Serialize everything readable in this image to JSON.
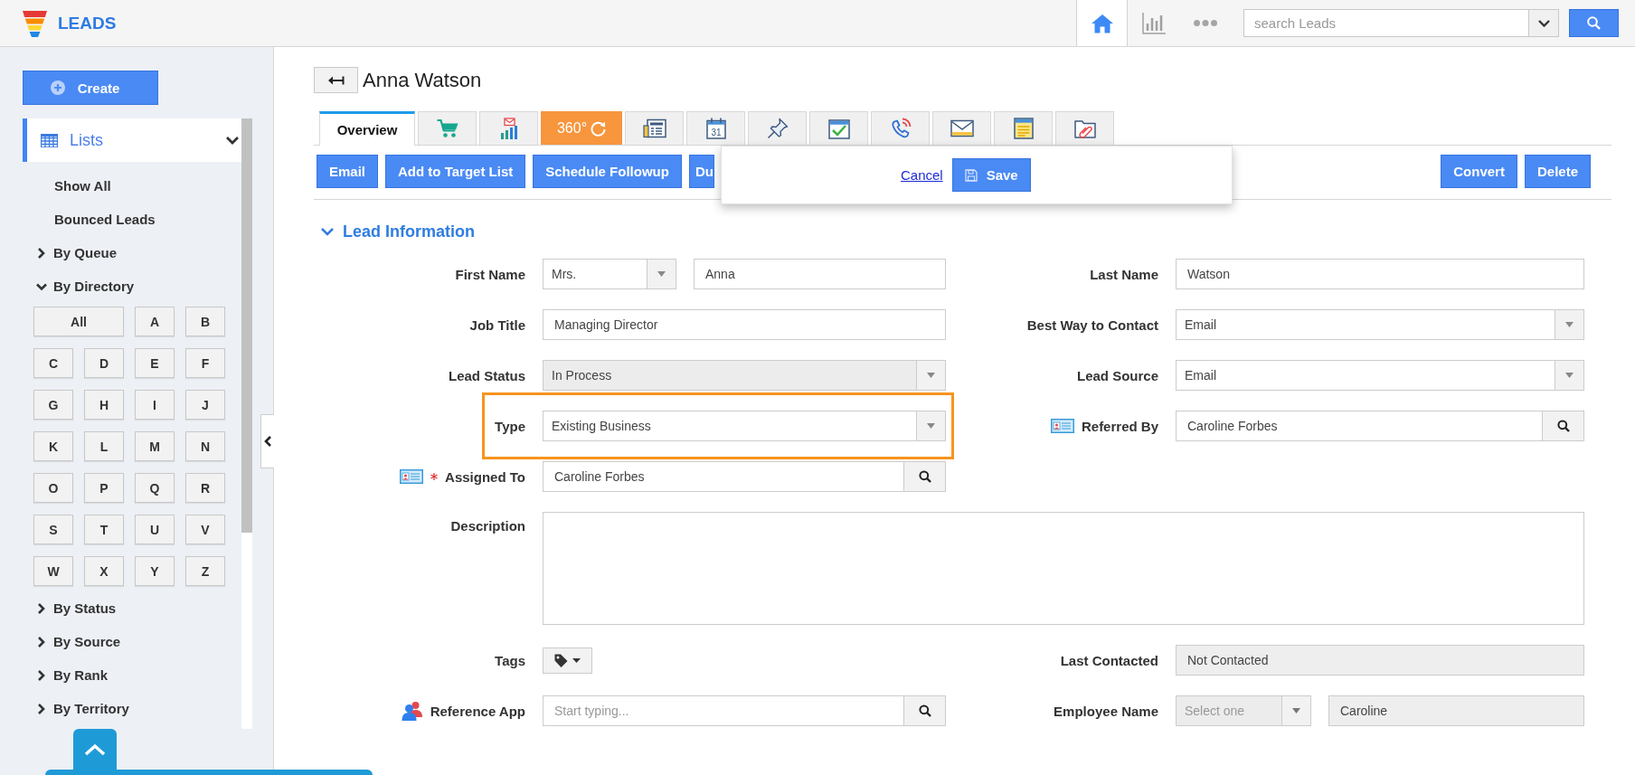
{
  "app": {
    "title": "LEADS"
  },
  "nav": [
    {
      "selected": true
    },
    {
      "selected": false
    },
    {
      "selected": false
    }
  ],
  "search": {
    "placeholder": "search Leads"
  },
  "sidebar": {
    "create": "Create",
    "lists": {
      "label": "Lists",
      "expanded": true
    },
    "links": [
      {
        "label": "Show All"
      },
      {
        "label": "Bounced Leads"
      }
    ],
    "groups": [
      {
        "label": "By Queue",
        "expanded": false
      },
      {
        "label": "By Directory",
        "expanded": true,
        "letters": [
          "All",
          "A",
          "B",
          "C",
          "D",
          "E",
          "F",
          "G",
          "H",
          "I",
          "J",
          "K",
          "L",
          "M",
          "N",
          "O",
          "P",
          "Q",
          "R",
          "S",
          "T",
          "U",
          "V",
          "W",
          "X",
          "Y",
          "Z"
        ]
      },
      {
        "label": "By Status",
        "expanded": false
      },
      {
        "label": "By Source",
        "expanded": false
      },
      {
        "label": "By Rank",
        "expanded": false
      },
      {
        "label": "By Territory",
        "expanded": false
      }
    ]
  },
  "record": {
    "title": "Anna Watson"
  },
  "tabs": [
    {
      "kind": "text",
      "label": "Overview",
      "selected": true
    },
    {
      "kind": "icon",
      "selected": false
    },
    {
      "kind": "icon",
      "selected": false
    },
    {
      "kind": "badge",
      "label": "360°",
      "selected": false
    },
    {
      "kind": "icon",
      "selected": false
    },
    {
      "kind": "calendar",
      "label": "31",
      "selected": false
    },
    {
      "kind": "icon",
      "selected": false
    },
    {
      "kind": "icon",
      "selected": false
    },
    {
      "kind": "icon",
      "selected": false
    },
    {
      "kind": "icon",
      "selected": false
    },
    {
      "kind": "icon",
      "selected": false
    },
    {
      "kind": "icon",
      "selected": false
    }
  ],
  "actions": {
    "left": [
      {
        "label": "Email",
        "covered": false
      },
      {
        "label": "Add to Target List",
        "covered": false
      },
      {
        "label": "Schedule Followup",
        "covered": false
      },
      {
        "label": "Du",
        "covered": true
      }
    ],
    "right": [
      {
        "label": "Convert"
      },
      {
        "label": "Delete"
      }
    ]
  },
  "popup": {
    "cancel": "Cancel",
    "save": "Save"
  },
  "form": {
    "title": "Lead Information",
    "expanded": true,
    "rows": [
      {
        "fields": [
          {
            "kind": "name",
            "label": "First Name",
            "salutation": "Mrs.",
            "value": "Anna",
            "disabled": false,
            "required": false,
            "highlighted": false
          },
          {
            "kind": "text",
            "label": "Last Name",
            "value": "Watson",
            "disabled": false,
            "required": false,
            "highlighted": false
          }
        ]
      },
      {
        "fields": [
          {
            "kind": "text",
            "label": "Job Title",
            "value": "Managing Director",
            "disabled": false,
            "required": false,
            "highlighted": false
          },
          {
            "kind": "select",
            "label": "Best Way to Contact",
            "value": "Email",
            "disabled": false,
            "required": false,
            "highlighted": false
          }
        ]
      },
      {
        "fields": [
          {
            "kind": "select",
            "label": "Lead Status",
            "value": "In Process",
            "disabled": true,
            "required": false,
            "highlighted": false
          },
          {
            "kind": "select",
            "label": "Lead Source",
            "value": "Email",
            "disabled": false,
            "required": false,
            "highlighted": false
          }
        ]
      },
      {
        "fields": [
          {
            "kind": "select",
            "label": "Type",
            "value": "Existing Business",
            "disabled": false,
            "required": false,
            "highlighted": true
          },
          {
            "kind": "lookup",
            "label": "Referred By",
            "value": "Caroline Forbes",
            "disabled": false,
            "required": false,
            "highlighted": false
          }
        ]
      },
      {
        "fields": [
          {
            "kind": "lookup",
            "label": "Assigned To",
            "value": "Caroline Forbes",
            "disabled": false,
            "required": true,
            "highlighted": false
          }
        ]
      },
      {
        "fields": [
          {
            "kind": "textarea",
            "label": "Description",
            "disabled": false,
            "required": false,
            "highlighted": false
          }
        ]
      },
      {
        "fields": [
          {
            "kind": "tags",
            "label": "Tags",
            "disabled": false,
            "required": false,
            "highlighted": false
          },
          {
            "kind": "text",
            "label": "Last Contacted",
            "value": "Not Contacted",
            "disabled": true,
            "required": false,
            "highlighted": false
          }
        ]
      },
      {
        "fields": [
          {
            "kind": "reference",
            "label": "Reference App",
            "placeholder": "Start typing...",
            "disabled": false,
            "required": false,
            "highlighted": false
          },
          {
            "kind": "employee",
            "label": "Employee Name",
            "placeholder": "Select one",
            "value": "Caroline",
            "disabled": true,
            "required": false,
            "highlighted": false
          }
        ]
      }
    ]
  }
}
